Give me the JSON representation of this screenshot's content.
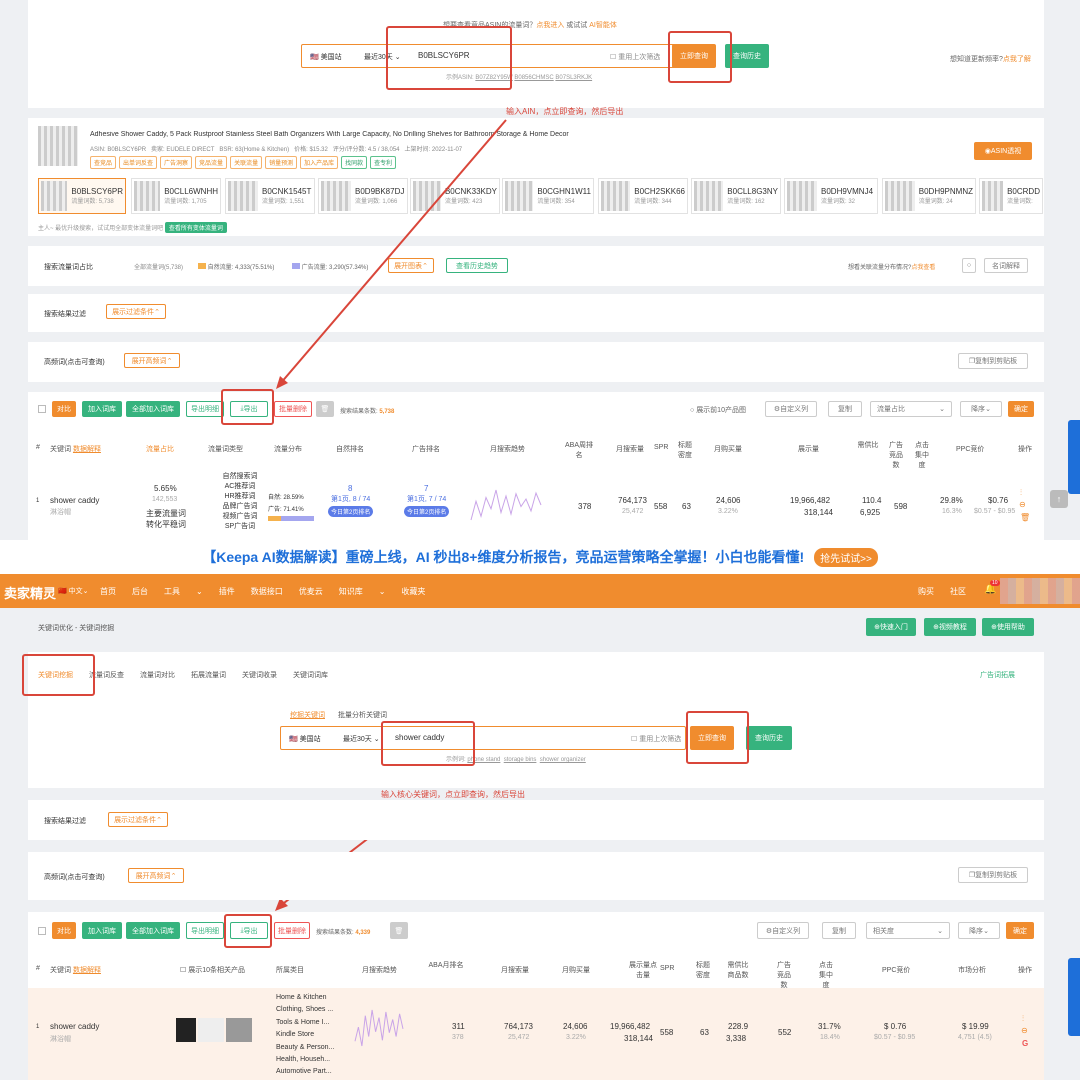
{
  "top": {
    "tabs": [
      "关键词挖掘",
      "流量词反查",
      "流量词对比",
      "拓展流量词",
      "关键词收录",
      "关键词词库"
    ],
    "hint": "想要查看竞品ASIN的流量词？",
    "hint_link1": "点我进入",
    "hint_mid": "或试试",
    "hint_link2": "AI智能体",
    "site": "美国站",
    "period": "最近30天",
    "query": "B0BLSCY6PR",
    "reuse": "重用上次筛选",
    "search_btn": "立即查询",
    "history_btn": "查询历史",
    "example_label": "示例ASIN:",
    "examples": [
      "B07Z82Y95W",
      "B0856CHMSC",
      "B07SL3RKJK"
    ],
    "right_hint": "想知道更新频率?",
    "right_link": "点我了解",
    "annotation": "输入AIN，点立即查询，然后导出"
  },
  "product": {
    "title": "Adhesive Shower Caddy, 5 Pack Rustproof Stainless Steel Bath Organizers With Large Capacity, No Drilling Shelves for Bathroom Storage & Home Decor",
    "meta": [
      "ASIN: B0BLSCY6PR",
      "卖家: EUDELE DIRECT",
      "BSR: 63(Home & Kitchen)",
      "价格: $15.32",
      "评分/评分数: 4.5 / 38,054",
      "上架时间: 2022-11-07"
    ],
    "tags": [
      "查竞品",
      "出单词反查",
      "广告洞察",
      "竞品流量",
      "关联流量",
      "销量预测",
      "加入产品库",
      "找同款",
      "查专利"
    ],
    "asin_btn": "ASIN透视",
    "variants": [
      {
        "code": "B0BLSCY6PR",
        "sub": "流量词数: 5,738"
      },
      {
        "code": "B0CLL6WNHH",
        "sub": "流量词数: 1,705"
      },
      {
        "code": "B0CNK1545T",
        "sub": "流量词数: 1,551"
      },
      {
        "code": "B0D9BK87DJ",
        "sub": "流量词数: 1,066"
      },
      {
        "code": "B0CNK33KDY",
        "sub": "流量词数: 423"
      },
      {
        "code": "B0CGHN1W11",
        "sub": "流量词数: 354"
      },
      {
        "code": "B0CH2SKK66",
        "sub": "流量词数: 344"
      },
      {
        "code": "B0CLL8G3NY",
        "sub": "流量词数: 162"
      },
      {
        "code": "B0DH9VMNJ4",
        "sub": "流量词数: 32"
      },
      {
        "code": "B0DH9PNMNZ",
        "sub": "流量词数: 24"
      },
      {
        "code": "B0CRDD",
        "sub": "流量词数:"
      }
    ],
    "note": "主人~ 最优升级搜索，试试用全部变体流量词吧",
    "note_btn": "查看所有变体流量词"
  },
  "traffic": {
    "label": "搜索流量词占比",
    "all": "全部流量词(5,738)",
    "natural": "自然流量: 4,333(75.51%)",
    "ad": "广告流量: 3,290(57.34%)",
    "expand": "展开图表",
    "history": "查看历史趋势",
    "right": "想看关联流量分布情况?",
    "right_link": "点我查看",
    "explain": "名词解释"
  },
  "filter": {
    "label": "搜索结果过滤",
    "btn": "展示过滤条件"
  },
  "freq": {
    "label": "高频词(点击可查询)",
    "btn": "展开高频词",
    "copy": "复制到剪贴板"
  },
  "table1": {
    "buttons": [
      "对比",
      "加入词库",
      "全部加入词库",
      "导出明细",
      "导出",
      "批量删除"
    ],
    "count_label": "搜索结果条数:",
    "count": "5,738",
    "top10": "展示前10产品图",
    "custom": "自定义列",
    "copy": "复制",
    "sort": "流量占比",
    "order": "降序",
    "confirm": "确定",
    "headers": [
      "关键词",
      "流量词类型",
      "流量分布",
      "自然排名",
      "广告排名",
      "月搜索趋势",
      "ABA周排名",
      "月搜索量",
      "SPR",
      "标题密度",
      "月购买量",
      "展示量",
      "需供比",
      "广告竞品数",
      "点击集中度",
      "PPC竞价",
      "操作"
    ],
    "kw_note": "数据解释",
    "share_label": "流量占比",
    "row": {
      "kw": "shower caddy",
      "kw_cn": "淋浴帽",
      "share": "5.65%",
      "share_sub": "142,553",
      "share_t1": "主要流量词",
      "share_t2": "转化平稳词",
      "types": [
        "自然搜索词",
        "AC推荐词",
        "HR推荐词",
        "品牌广告词",
        "视频广告词",
        "SP广告词"
      ],
      "dist_nat": "自然: 28.59%",
      "dist_ad": "广告: 71.41%",
      "nat_rank": "8",
      "nat_sub": "第1页, 8 / 74",
      "nat_badge": "今日第2页排名",
      "ad_rank": "7",
      "ad_sub": "第1页, 7 / 74",
      "ad_badge": "今日第2页排名",
      "aba": "378",
      "search": "764,173",
      "search_sub": "25,472",
      "spr": "558",
      "density": "63",
      "buy": "24,606",
      "buy_sub": "3.22%",
      "impr": "19,966,482",
      "impr_sub": "318,144",
      "ratio": "110.4",
      "ratio_sub": "6,925",
      "adc": "598",
      "click": "29.8%",
      "click_sub": "16.3%",
      "ppc": "$0.76",
      "ppc_sub": "$0.57 - $0.95"
    },
    "trend": [
      30,
      55,
      35,
      60,
      45,
      70,
      40,
      62,
      38,
      65,
      48,
      58,
      42,
      66,
      50
    ]
  },
  "banner": {
    "text": "【Keepa AI数据解读】重磅上线，AI 秒出8+维度分析报告，竞品运营策略全掌握！小白也能看懂!",
    "btn": "抢先试试>>"
  },
  "nav": {
    "logo": "卖家精灵",
    "lang": "中文",
    "items": [
      "首页",
      "后台",
      "工具",
      "插件",
      "数据接口",
      "优麦云",
      "知识库",
      "收藏夹"
    ],
    "right": [
      "购买",
      "社区"
    ],
    "badge": "10"
  },
  "bottom": {
    "breadcrumb": "关键词优化 - 关键词挖掘",
    "quick": [
      "快速入门",
      "视频教程",
      "使用帮助"
    ],
    "tabs": [
      "关键词挖掘",
      "流量词反查",
      "流量词对比",
      "拓展流量词",
      "关键词收录",
      "关键词词库"
    ],
    "tab_right": "广告词拓展",
    "modes": [
      "挖掘关键词",
      "批量分析关键词"
    ],
    "site": "美国站",
    "period": "最近30天",
    "query": "shower caddy",
    "reuse": "重用上次筛选",
    "search_btn": "立即查询",
    "history_btn": "查询历史",
    "example_label": "示例词:",
    "examples": [
      "phone stand",
      "storage bins",
      "shower organizer"
    ],
    "annotation": "输入核心关键词，点立即查询，然后导出"
  },
  "filter2": {
    "label": "搜索结果过滤",
    "btn": "展示过滤条件"
  },
  "freq2": {
    "label": "高频词(点击可查询)",
    "btn": "展开高频词",
    "copy": "复制到剪贴板"
  },
  "table2": {
    "buttons": [
      "对比",
      "加入词库",
      "全部加入词库",
      "导出明细",
      "导出",
      "批量删除"
    ],
    "count_label": "搜索结果条数:",
    "count": "4,339",
    "custom": "自定义列",
    "copy": "复制",
    "sort": "相关度",
    "order": "降序",
    "confirm": "确定",
    "headers": [
      "关键词",
      "展示10条相关产品",
      "所属类目",
      "月搜索趋势",
      "ABA月排名",
      "月搜索量",
      "月购买量",
      "展示量点击量",
      "SPR",
      "标题密度",
      "需供比商品数",
      "广告竞品数",
      "点击集中度",
      "PPC竞价",
      "市场分析",
      "操作"
    ],
    "kw_note": "数据解释",
    "row": {
      "kw": "shower caddy",
      "kw_cn": "淋浴帽",
      "cats": [
        "Home & Kitchen",
        "Clothing, Shoes ...",
        "Tools & Home I...",
        "Kindle Store",
        "Beauty & Person...",
        "Health, Househ...",
        "Automotive Part..."
      ],
      "aba": "311",
      "aba_sub": "378",
      "search": "764,173",
      "search_sub": "25,472",
      "buy": "24,606",
      "buy_sub": "3.22%",
      "impr": "19,966,482",
      "impr_sub": "318,144",
      "spr": "558",
      "density": "63",
      "ratio": "228.9",
      "ratio_sub": "3,338",
      "adc": "552",
      "click": "31.7%",
      "click_sub": "18.4%",
      "ppc": "$ 0.76",
      "ppc_sub": "$0.57 - $0.95",
      "mkt": "$ 19.99",
      "mkt_sub": "4,751 (4.5)"
    },
    "trend": [
      35,
      50,
      30,
      62,
      40,
      68,
      45,
      60,
      36,
      66,
      44,
      58,
      40,
      64,
      48
    ]
  },
  "colors": {
    "orange": "#f08c2e",
    "green": "#36b37e",
    "red_box": "#d9463a",
    "banner_blue": "#1e6fd9"
  }
}
